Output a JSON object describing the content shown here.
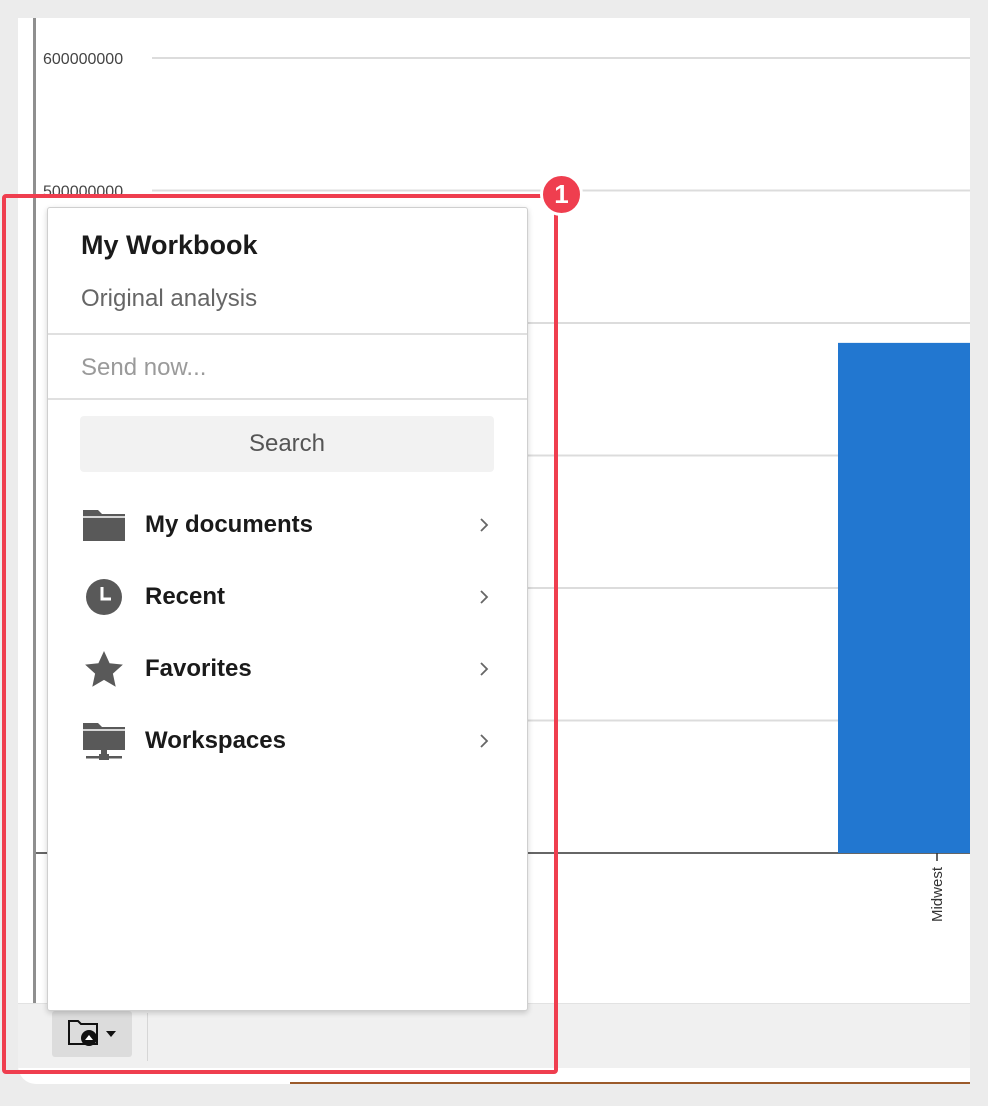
{
  "chart_data": {
    "type": "bar",
    "categories": [
      "Midwest"
    ],
    "values": [
      385000000
    ],
    "ylim": [
      0,
      625000000
    ],
    "y_ticks": [
      100000000,
      200000000,
      300000000,
      400000000,
      500000000,
      600000000
    ],
    "y_tick_labels": [
      "",
      "",
      "",
      "",
      "500000000",
      "600000000"
    ],
    "grid": true,
    "bar_color": "#2277d0"
  },
  "dropdown": {
    "title": "My Workbook",
    "subtitle": "Original analysis",
    "send_placeholder": "Send now...",
    "search_label": "Search",
    "items": [
      {
        "label": "My documents",
        "icon": "folder-icon"
      },
      {
        "label": "Recent",
        "icon": "clock-icon"
      },
      {
        "label": "Favorites",
        "icon": "star-icon"
      },
      {
        "label": "Workspaces",
        "icon": "network-folder-icon"
      }
    ]
  },
  "toolbar": {
    "folder_button_icon": "folder-upload-icon"
  },
  "annotation": {
    "step_number": "1",
    "color": "#ef3e4f"
  }
}
